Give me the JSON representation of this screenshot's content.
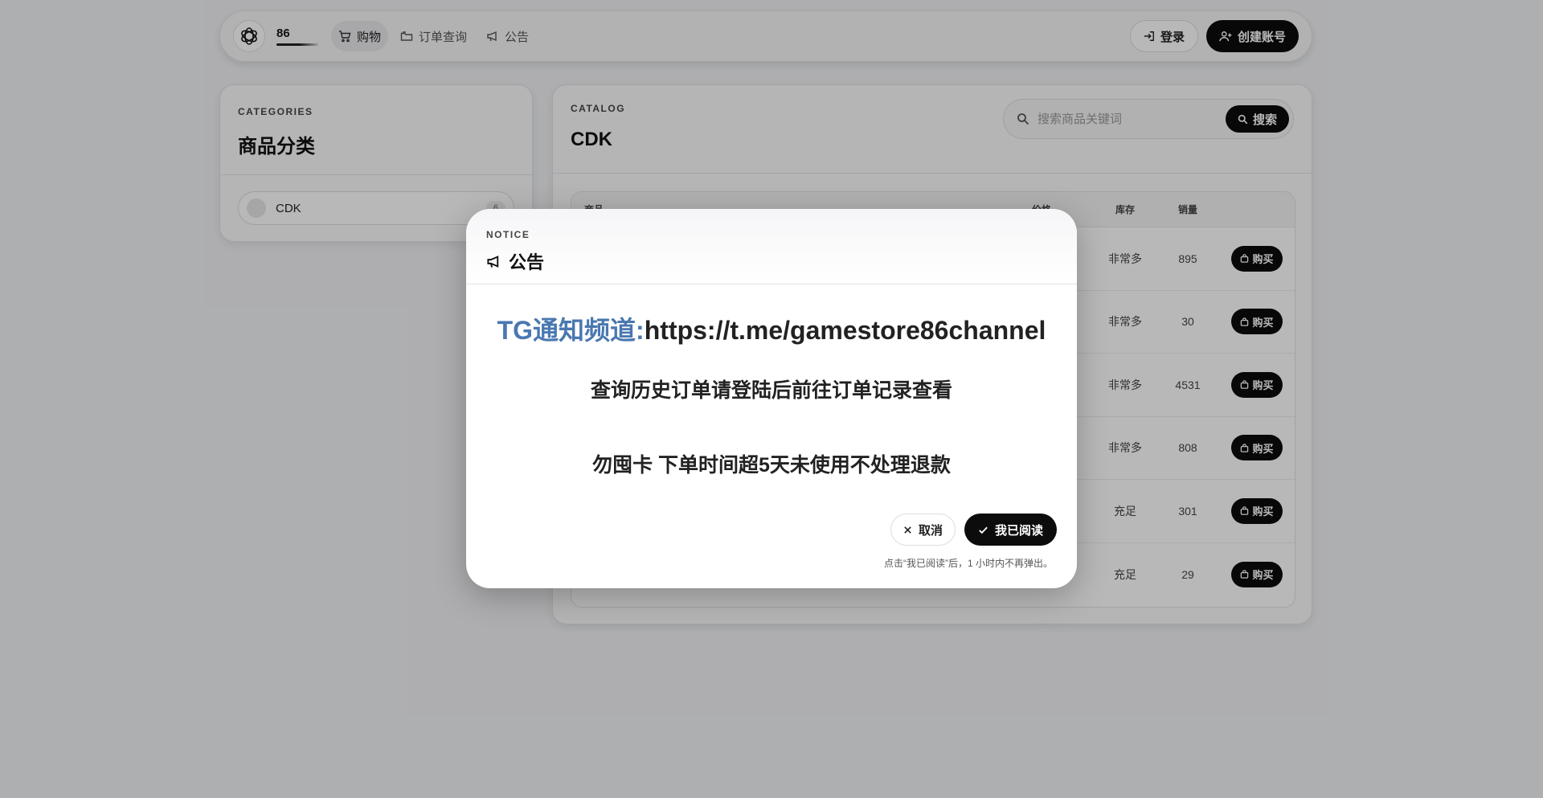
{
  "header": {
    "brand_name": "86",
    "nav": [
      {
        "label": "购物",
        "icon": "cart-icon",
        "active": true
      },
      {
        "label": "订单查询",
        "icon": "folder-icon",
        "active": false
      },
      {
        "label": "公告",
        "icon": "megaphone-icon",
        "active": false
      }
    ],
    "login_label": "登录",
    "register_label": "创建账号"
  },
  "categories": {
    "eyebrow": "CATEGORIES",
    "title": "商品分类",
    "items": [
      {
        "label": "CDK",
        "count": "6"
      }
    ]
  },
  "catalog": {
    "eyebrow": "CATALOG",
    "title": "CDK",
    "search_placeholder": "搜索商品关键词",
    "search_button": "搜索",
    "columns": {
      "name": "商品",
      "price": "价格",
      "stock": "库存",
      "sold": "销量"
    },
    "buy_label": "购买",
    "rows": [
      {
        "stock": "非常多",
        "sold": "895"
      },
      {
        "stock": "非常多",
        "sold": "30"
      },
      {
        "stock": "非常多",
        "sold": "4531"
      },
      {
        "stock": "非常多",
        "sold": "808"
      },
      {
        "stock": "充足",
        "sold": "301"
      },
      {
        "stock": "充足",
        "sold": "29"
      }
    ]
  },
  "modal": {
    "eyebrow": "NOTICE",
    "title": "公告",
    "tg_label": "TG通知频道:",
    "tg_link": "https://t.me/gamestore86channel",
    "line1": "查询历史订单请登陆后前往订单记录查看",
    "line2": "勿囤卡 下单时间超5天未使用不处理退款",
    "cancel_label": "取消",
    "confirm_label": "我已阅读",
    "hint": "点击“我已阅读”后，1 小时内不再弹出。",
    "tg_color": "#4a78b0"
  }
}
